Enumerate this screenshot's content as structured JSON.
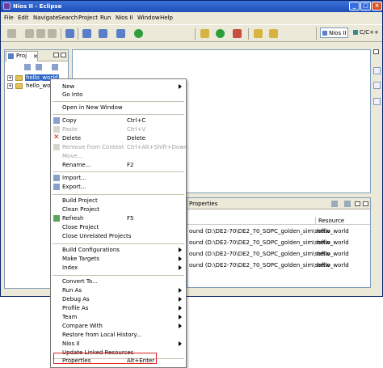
{
  "window": {
    "title": "Nios II - Eclipse"
  },
  "menubar": [
    "File",
    "Edit",
    "Navigate",
    "Search",
    "Project",
    "Run",
    "Nios II",
    "Window",
    "Help"
  ],
  "perspectives": {
    "nios": "Nios II",
    "cpp": "C/C++"
  },
  "project_panel": {
    "tab_label": "Proj",
    "items": [
      {
        "label": "hello_world"
      },
      {
        "label": "hello_world_syslib"
      }
    ]
  },
  "properties_panel": {
    "tab_label": "Properties",
    "resource_header": "Resource",
    "rows": [
      {
        "path": "ound (D:\\DE2-70\\DE2_70_SOPC_golden_sim\\softw",
        "resource": "hello_world"
      },
      {
        "path": "ound (D:\\DE2-70\\DE2_70_SOPC_golden_sim\\softw",
        "resource": "hello_world"
      },
      {
        "path": "ound (D:\\DE2-70\\DE2_70_SOPC_golden_sim\\softw",
        "resource": "hello_world"
      },
      {
        "path": "ound (D:\\DE2-70\\DE2_70_SOPC_golden_sim\\softw",
        "resource": "hello_world"
      }
    ]
  },
  "context_menu": {
    "new": "New",
    "go_into": "Go Into",
    "open_new_window": "Open in New Window",
    "copy": "Copy",
    "copy_acc": "Ctrl+C",
    "paste": "Paste",
    "paste_acc": "Ctrl+V",
    "delete": "Delete",
    "delete_acc": "Delete",
    "remove_context": "Remove from Context",
    "remove_context_acc": "Ctrl+Alt+Shift+Down",
    "move": "Move...",
    "rename": "Rename...",
    "rename_acc": "F2",
    "import": "Import...",
    "export": "Export...",
    "build_project": "Build Project",
    "clean_project": "Clean Project",
    "refresh": "Refresh",
    "refresh_acc": "F5",
    "close_project": "Close Project",
    "close_unrelated": "Close Unrelated Projects",
    "build_configurations": "Build Configurations",
    "make_targets": "Make Targets",
    "index": "Index",
    "convert_to": "Convert To...",
    "run_as": "Run As",
    "debug_as": "Debug As",
    "profile_as": "Profile As",
    "team": "Team",
    "compare_with": "Compare With",
    "restore_history": "Restore from Local History...",
    "nios2": "Nios II",
    "update_linked": "Update Linked Resources",
    "properties": "Properties",
    "properties_acc": "Alt+Enter"
  },
  "colors": {
    "title_bar": "#1f4fb8",
    "selection": "#316ac5",
    "highlight_box": "#e02020",
    "chrome": "#ece9d8"
  }
}
